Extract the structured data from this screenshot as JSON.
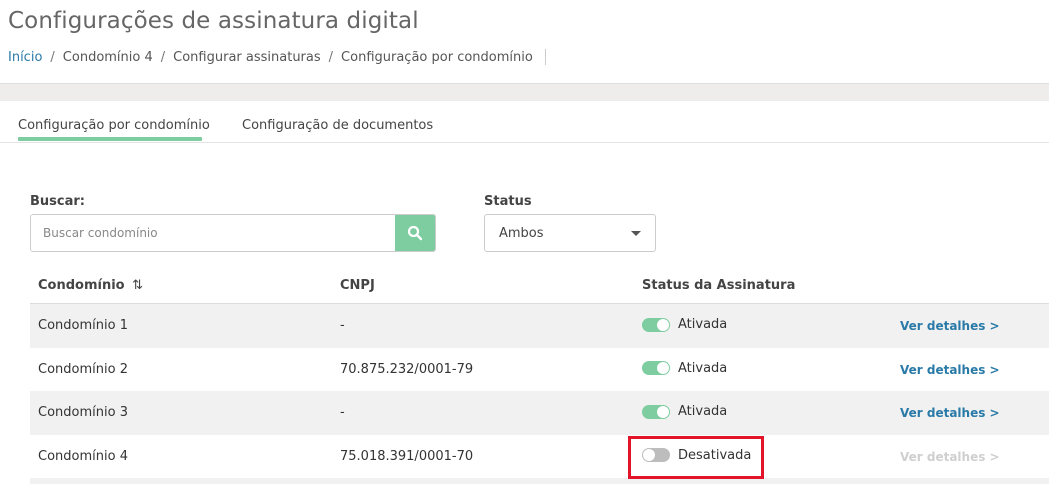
{
  "header": {
    "title": "Configurações de assinatura digital",
    "breadcrumb": [
      "Início",
      "Condomínio 4",
      "Configurar assinaturas",
      "Configuração por condomínio"
    ],
    "separator": "/"
  },
  "tabs": [
    {
      "label": "Configuração por condomínio",
      "active": true
    },
    {
      "label": "Configuração de documentos",
      "active": false
    }
  ],
  "filters": {
    "search_label": "Buscar:",
    "search_placeholder": "Buscar condomínio",
    "search_value": "",
    "status_label": "Status",
    "status_value": "Ambos"
  },
  "table": {
    "columns": [
      "Condomínio",
      "CNPJ",
      "Status da Assinatura"
    ],
    "sort_icon": "⇅",
    "rows": [
      {
        "name": "Condomínio 1",
        "cnpj": "-",
        "status": "Ativada",
        "enabled": true,
        "link": "Ver detalhes >"
      },
      {
        "name": "Condomínio 2",
        "cnpj": "70.875.232/0001-79",
        "status": "Ativada",
        "enabled": true,
        "link": "Ver detalhes >"
      },
      {
        "name": "Condomínio 3",
        "cnpj": "-",
        "status": "Ativada",
        "enabled": true,
        "link": "Ver detalhes >"
      },
      {
        "name": "Condomínio 4",
        "cnpj": "75.018.391/0001-70",
        "status": "Desativada",
        "enabled": false,
        "link": "Ver detalhes >"
      }
    ]
  },
  "colors": {
    "accent_green": "#7dcda0",
    "link_blue": "#2a7aa8",
    "highlight_red": "#e3142a"
  }
}
